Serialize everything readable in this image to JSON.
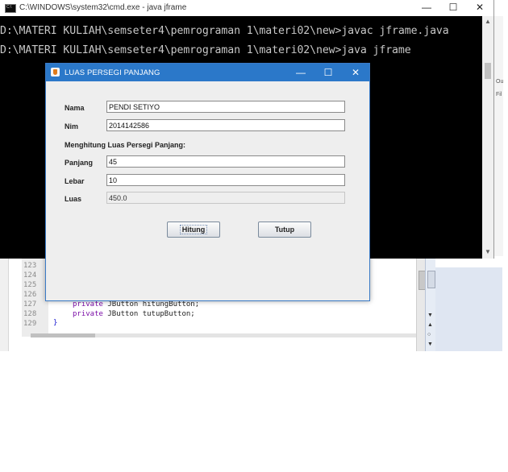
{
  "cmd_window": {
    "title": "C:\\WINDOWS\\system32\\cmd.exe - java  jframe",
    "minimize_glyph": "—",
    "maximize_glyph": "☐",
    "close_glyph": "✕",
    "lines": [
      "D:\\MATERI KULIAH\\semseter4\\pemrograman 1\\materi02\\new>javac jframe.java",
      "D:\\MATERI KULIAH\\semseter4\\pemrograman 1\\materi02\\new>java jframe"
    ]
  },
  "editor": {
    "line_numbers": [
      "123",
      "124",
      "125",
      "126",
      "127",
      "128",
      "129"
    ],
    "code_lines": [
      {
        "keyword": "private",
        "rest": " JButton hitungButton;"
      },
      {
        "keyword": "private",
        "rest": " JButton tutupButton;"
      }
    ],
    "closing_brace": "}"
  },
  "right_pane_text": [
    "Ou",
    "Fil"
  ],
  "dialog": {
    "title": "LUAS PERSEGI PANJANG",
    "minimize_glyph": "—",
    "maximize_glyph": "☐",
    "close_glyph": "✕",
    "nama_label": "Nama",
    "nama_value": "PENDI SETIYO",
    "nim_label": "Nim",
    "nim_value": "2014142586",
    "section_heading": "Menghitung Luas Persegi Panjang:",
    "panjang_label": "Panjang",
    "panjang_value": "45",
    "lebar_label": "Lebar",
    "lebar_value": "10",
    "luas_label": "Luas",
    "luas_value": "450.0",
    "hitung_button": "Hitung",
    "tutup_button": "Tutup"
  }
}
